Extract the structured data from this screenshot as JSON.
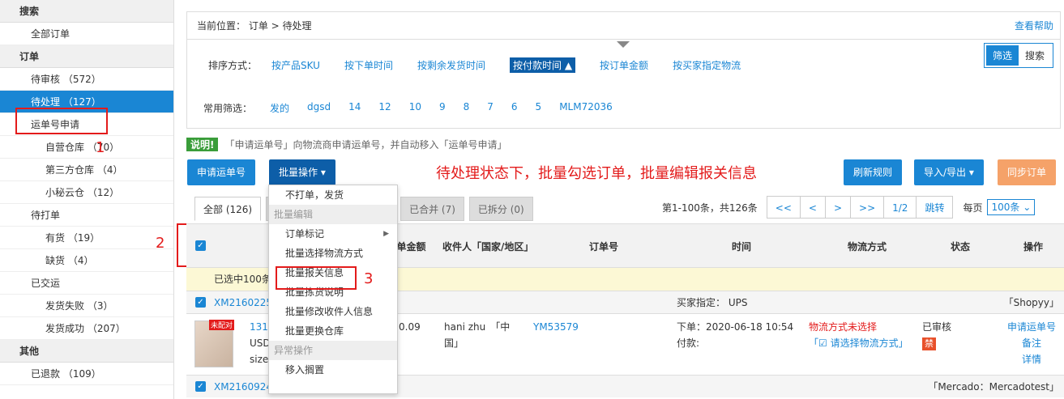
{
  "sidebar": {
    "sections": [
      {
        "head": "搜索",
        "items": [
          {
            "label": "全部订单",
            "sub": false
          }
        ]
      },
      {
        "head": "订单",
        "items": [
          {
            "label": "待审核 （572）",
            "sub": false
          },
          {
            "label": "待处理 （127）",
            "sub": false,
            "active": true
          },
          {
            "label": "运单号申请",
            "sub": false
          },
          {
            "label": "自营仓库 （70）",
            "sub": true
          },
          {
            "label": "第三方仓库 （4）",
            "sub": true
          },
          {
            "label": "小秘云仓 （12）",
            "sub": true
          },
          {
            "label": "待打单",
            "sub": false
          },
          {
            "label": "有货 （19）",
            "sub": true
          },
          {
            "label": "缺货 （4）",
            "sub": true
          },
          {
            "label": "已交运",
            "sub": false
          },
          {
            "label": "发货失败 （3）",
            "sub": true
          },
          {
            "label": "发货成功 （207）",
            "sub": true
          }
        ]
      },
      {
        "head": "其他",
        "items": [
          {
            "label": "已退款 （109）",
            "sub": false
          }
        ]
      }
    ]
  },
  "annotations": {
    "n1": "1",
    "n2": "2",
    "n3": "3",
    "note": "待处理状态下，批量勾选订单，批量编辑报关信息"
  },
  "breadcrumb": "当前位置： 订单 > 待处理",
  "help_link": "查看帮助",
  "sort": {
    "label": "排序方式：",
    "options": [
      "按产品SKU",
      "按下单时间",
      "按剩余发货时间",
      "按付款时间 ▲",
      "按订单金额",
      "按买家指定物流"
    ],
    "active_index": 3
  },
  "toggle": {
    "filter": "筛选",
    "search": "搜索"
  },
  "filter": {
    "label": "常用筛选：",
    "options": [
      "发的",
      "dgsd",
      "14",
      "12",
      "10",
      "9",
      "8",
      "7",
      "6",
      "5",
      "MLM72036"
    ]
  },
  "notice": {
    "badge": "说明!",
    "text": "「申请运单号」向物流商申请运单号，并自动移入「运单号申请」"
  },
  "buttons": {
    "apply": "申请运单号",
    "batch": "批量操作 ▾",
    "refresh": "刷新规则",
    "import_export": "导入/导出 ▾",
    "sync": "同步订单"
  },
  "tabs": [
    "全部 (126)",
    "已合并 (7)",
    "已拆分 (0)"
  ],
  "pager": {
    "info": "第1-100条，共126条",
    "buttons": [
      "<<",
      "<",
      ">",
      ">>",
      "1/2",
      "跳转"
    ],
    "per_page_label": "每页",
    "per_page_value": "100条"
  },
  "table": {
    "headers": [
      "单金额",
      "收件人「国家/地区」",
      "订单号",
      "时间",
      "物流方式",
      "状态",
      "操作"
    ],
    "selected_text": "已选中100条",
    "orders": [
      {
        "id": "XM2160225",
        "buyer_spec": "买家指定： UPS",
        "store": "「Shopyy」"
      },
      {
        "id": "XM2160924",
        "store": "「Mercado：Mercadotest」"
      }
    ],
    "detail": {
      "thumb_tag": "未配对",
      "title": "1317",
      "price_prefix": "USD",
      "size_prefix": "size",
      "amount": "0.09",
      "recipient": "hani zhu　「中国」",
      "order_no": "YM53579",
      "order_time": "下单：2020-06-18 10:54",
      "pay_time": "付款:",
      "logistics_warn": "物流方式未选择",
      "logistics_link": "「☑ 请选择物流方式」",
      "status": "已审核",
      "ban": "禁",
      "actions": [
        "申请运单号",
        "备注",
        "详情"
      ]
    }
  },
  "menu": {
    "items": [
      {
        "type": "item",
        "label": "不打单，发货"
      },
      {
        "type": "group",
        "label": "批量编辑"
      },
      {
        "type": "item",
        "label": "订单标记",
        "arrow": true
      },
      {
        "type": "item",
        "label": "批量选择物流方式"
      },
      {
        "type": "item",
        "label": "批量报关信息"
      },
      {
        "type": "item",
        "label": "批量拣货说明"
      },
      {
        "type": "item",
        "label": "批量修改收件人信息"
      },
      {
        "type": "item",
        "label": "批量更换仓库"
      },
      {
        "type": "group",
        "label": "异常操作"
      },
      {
        "type": "item",
        "label": "移入搁置"
      }
    ]
  }
}
